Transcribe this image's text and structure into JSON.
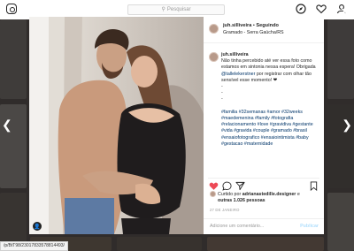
{
  "topbar": {
    "search_placeholder": "Pesquisar"
  },
  "post": {
    "username": "juh.silliveira",
    "follow_label": "Seguindo",
    "location": "Gramado - Serra Gaúcha/RS",
    "caption_user": "juh.silliveira",
    "caption_text": "Não tinha percebido até ver essa foto como estamos em sintonia nessa espera! Obrigada ",
    "caption_mention": "@tallelekerstner",
    "caption_text2": " por registrar com olhar tão sensível esse momento! ❤",
    "caption_dots": "-\n-\n-",
    "hashtags": "#familia #32semanas #amor #32weeks #maedemenina #family #fotografia #relacionamento #love #gravidiva #gestante #vida #gravida #couple #gramado #brasil #ensaiofotografico #ensaiointimista #baby #gestacao #maternidade",
    "liked_by_prefix": "Curtido por ",
    "liked_by_user": "adrianastedille.designer",
    "liked_by_and": " e",
    "liked_by_others": "outras 1.026 pessoas",
    "date": "27 DE JANEIRO",
    "comment_placeholder": "Adicione um comentário...",
    "publish_label": "Publicar"
  },
  "status_url": "/p/BtT98/23017833578814493/",
  "icons": [
    "instagram-logo",
    "search-icon",
    "compass-icon",
    "heart-icon",
    "user-icon",
    "close-icon",
    "chevron-left-icon",
    "chevron-right-icon",
    "heart-filled-icon",
    "comment-icon",
    "share-icon",
    "bookmark-icon"
  ],
  "colors": {
    "liked": "#ed4956",
    "link": "#003569",
    "publish_disabled": "#b2dffc"
  }
}
